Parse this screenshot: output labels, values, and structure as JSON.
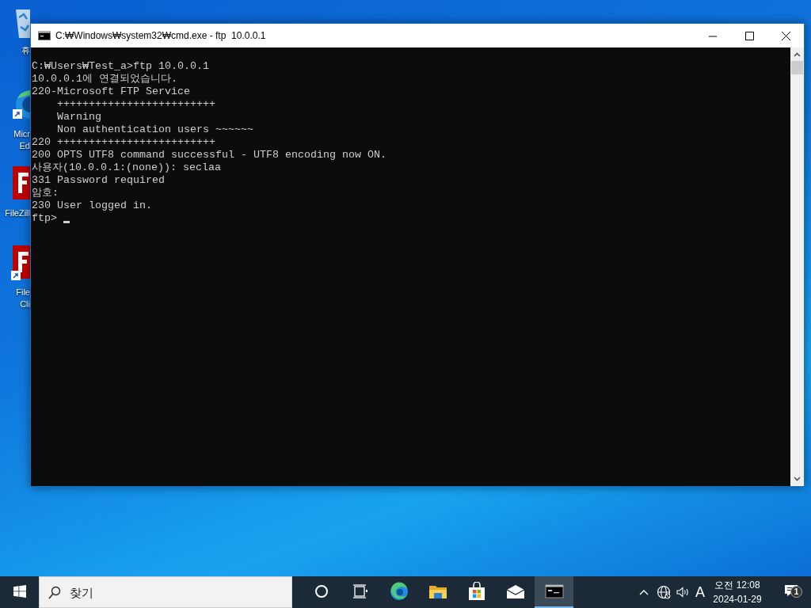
{
  "desktop_icons": [
    {
      "kind": "recycle",
      "label": "휴"
    },
    {
      "kind": "edge",
      "label": "Micr",
      "label2": "Ed"
    },
    {
      "kind": "filezilla",
      "label": "FileZill"
    },
    {
      "kind": "filezilla",
      "label": "File",
      "label2": "Cli",
      "shortcut": true
    }
  ],
  "window": {
    "title": "C:₩Windows₩system32₩cmd.exe - ftp  10.0.0.1",
    "lines": [
      "C:₩Users₩Test_a>ftp 10.0.0.1",
      "10.0.0.1에 연결되었습니다.",
      "220-Microsoft FTP Service",
      "    +++++++++++++++++++++++++",
      "    Warning",
      "    Non authentication users ~~~~~~",
      "220 +++++++++++++++++++++++++",
      "200 OPTS UTF8 command successful - UTF8 encoding now ON.",
      "사용자(10.0.0.1:(none)): seclaa",
      "331 Password required",
      "암호:",
      "230 User logged in."
    ],
    "prompt": "ftp> "
  },
  "taskbar": {
    "search_placeholder": "찾기",
    "apps": [
      {
        "kind": "cortana",
        "selected": false
      },
      {
        "kind": "taskview",
        "selected": false
      },
      {
        "kind": "edge",
        "selected": false
      },
      {
        "kind": "explorer",
        "selected": false
      },
      {
        "kind": "store",
        "selected": false
      },
      {
        "kind": "mail",
        "selected": false
      },
      {
        "kind": "cmd",
        "selected": true
      }
    ],
    "tray": {
      "ime": "A",
      "time": "오전 12:08",
      "date": "2024-01-29",
      "notifications": "1"
    }
  }
}
